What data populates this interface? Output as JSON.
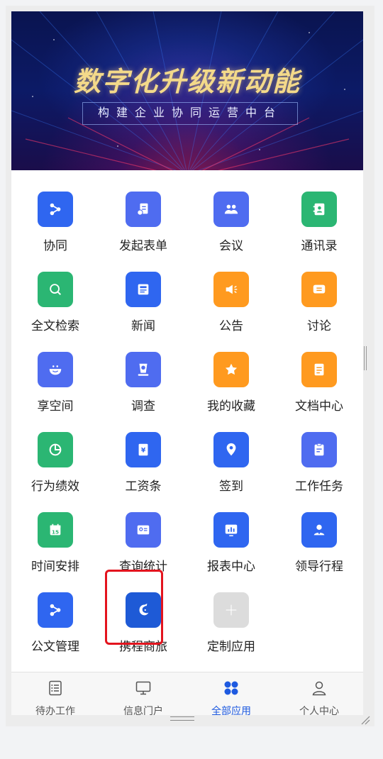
{
  "banner": {
    "title": "数字化升级新动能",
    "subtitle": "构建企业协同运营中台"
  },
  "apps": [
    {
      "label": "协同",
      "color": "#2f66f0",
      "icon": "share-icon"
    },
    {
      "label": "发起表单",
      "color": "#4f6cf0",
      "icon": "form-icon"
    },
    {
      "label": "会议",
      "color": "#4f6cf0",
      "icon": "people-icon"
    },
    {
      "label": "通讯录",
      "color": "#2bb673",
      "icon": "contact-book-icon"
    },
    {
      "label": "全文检索",
      "color": "#2bb673",
      "icon": "search-icon"
    },
    {
      "label": "新闻",
      "color": "#2f66f0",
      "icon": "news-icon"
    },
    {
      "label": "公告",
      "color": "#ff9a1f",
      "icon": "speaker-icon"
    },
    {
      "label": "讨论",
      "color": "#ff9a1f",
      "icon": "chat-icon"
    },
    {
      "label": "享空间",
      "color": "#4f6cf0",
      "icon": "bowl-icon"
    },
    {
      "label": "调查",
      "color": "#4f6cf0",
      "icon": "survey-icon"
    },
    {
      "label": "我的收藏",
      "color": "#ff9a1f",
      "icon": "star-icon"
    },
    {
      "label": "文档中心",
      "color": "#ff9a1f",
      "icon": "document-icon"
    },
    {
      "label": "行为绩效",
      "color": "#2bb673",
      "icon": "pie-chart-icon"
    },
    {
      "label": "工资条",
      "color": "#2f66f0",
      "icon": "salary-icon"
    },
    {
      "label": "签到",
      "color": "#2f66f0",
      "icon": "location-pin-icon"
    },
    {
      "label": "工作任务",
      "color": "#4f6cf0",
      "icon": "clipboard-icon"
    },
    {
      "label": "时间安排",
      "color": "#2bb673",
      "icon": "calendar-icon"
    },
    {
      "label": "查询统计",
      "color": "#4f6cf0",
      "icon": "query-card-icon"
    },
    {
      "label": "报表中心",
      "color": "#2f66f0",
      "icon": "bar-chart-icon"
    },
    {
      "label": "领导行程",
      "color": "#2f66f0",
      "icon": "leader-icon"
    },
    {
      "label": "公文管理",
      "color": "#2f66f0",
      "icon": "share-icon"
    },
    {
      "label": "携程商旅",
      "color": "#1e5ad6",
      "icon": "ctrip-dolphin-icon"
    },
    {
      "label": "定制应用",
      "color": "#dcdcdc",
      "icon": "plus-icon"
    }
  ],
  "tabs": [
    {
      "label": "待办工作",
      "icon": "todo-list-icon",
      "active": false
    },
    {
      "label": "信息门户",
      "icon": "monitor-icon",
      "active": false
    },
    {
      "label": "全部应用",
      "icon": "apps-grid-icon",
      "active": true
    },
    {
      "label": "个人中心",
      "icon": "user-icon",
      "active": false
    }
  ],
  "colors": {
    "accent": "#1e5ae0",
    "highlight": "#e3141e"
  }
}
